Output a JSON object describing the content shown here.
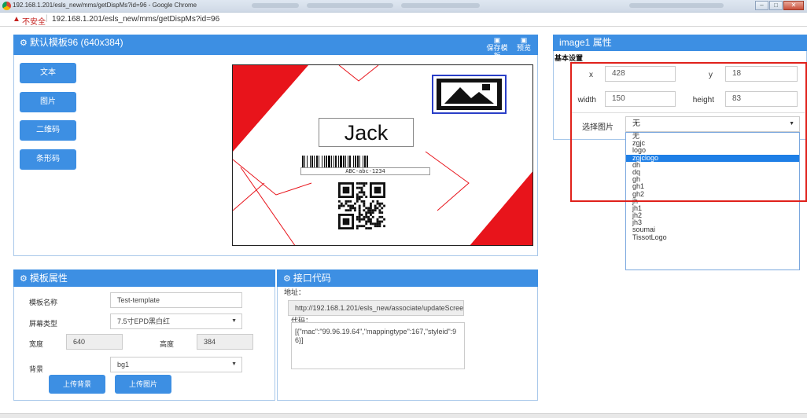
{
  "browser": {
    "window_title": "192.168.1.201/esls_new/mms/getDispMs?id=96 - Google Chrome",
    "insecure_label": "不安全",
    "url": "192.168.1.201/esls_new/mms/getDispMs?id=96"
  },
  "template_panel": {
    "title": "默认模板96 (640x384)",
    "save_label": "保存模板",
    "preview_label": "预览",
    "tools": [
      "文本",
      "图片",
      "二维码",
      "条形码"
    ]
  },
  "canvas": {
    "name_text": "Jack",
    "barcode_text": "ABC-abc-1234"
  },
  "properties": {
    "title": "image1 属性",
    "section": "基本设置",
    "x_label": "x",
    "x_value": "428",
    "y_label": "y",
    "y_value": "18",
    "width_label": "width",
    "width_value": "150",
    "height_label": "height",
    "height_value": "83",
    "image_label": "选择图片",
    "image_selected": "无",
    "image_options": [
      "无",
      "zgjc",
      "logo",
      "zgjclogo",
      "dh",
      "dq",
      "gh",
      "gh1",
      "gh2",
      "jh",
      "jh1",
      "jh2",
      "jh3",
      "soumai",
      "TissotLogo"
    ],
    "highlighted_option": "zgjclogo"
  },
  "template_props": {
    "title": "模板属性",
    "name_label": "模板名称",
    "name_value": "Test-template",
    "screen_label": "屏幕类型",
    "screen_value": "7.5寸EPD黑白红",
    "width_label": "宽度",
    "width_value": "640",
    "height_label": "高度",
    "height_value": "384",
    "bg_label": "背景",
    "bg_value": "bg1",
    "upload_bg_label": "上传背景",
    "upload_img_label": "上传图片"
  },
  "api_panel": {
    "title": "接口代码",
    "addr_label": "地址：",
    "addr_value": "http://192.168.1.201/esls_new/associate/updateScree",
    "code_label": "代码：",
    "code_value": "[{\"mac\":\"99.96.19.64\",\"mappingtype\":167,\"styleid\":96}]"
  },
  "colors": {
    "accent": "#3d8fe3",
    "highlight_border": "#e0211b",
    "canvas_red": "#e8141b",
    "selected_option": "#1e7fe6"
  }
}
